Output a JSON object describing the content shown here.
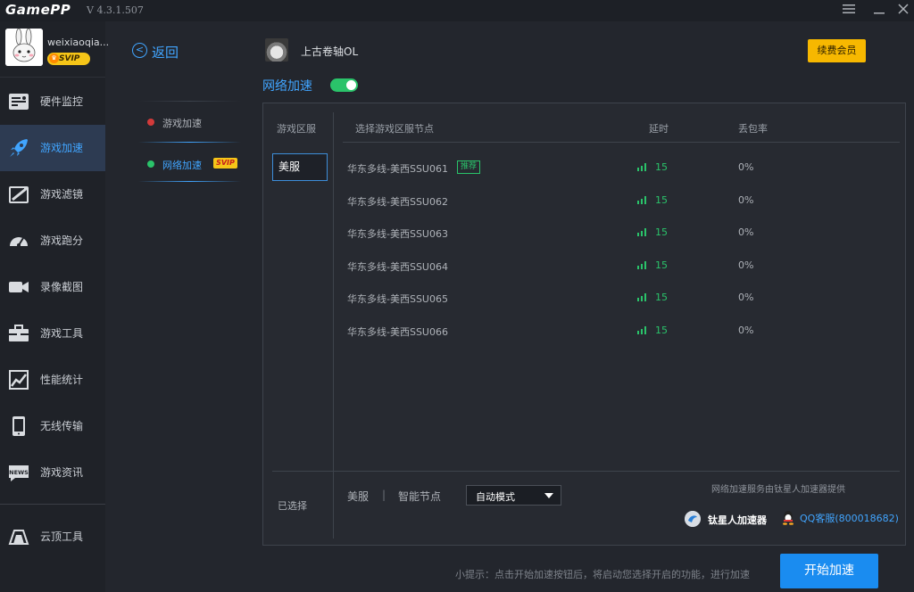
{
  "app": {
    "logo": "GamePP",
    "version": "V 4.3.1.507"
  },
  "window_controls": {
    "menu_icon": "menu-icon",
    "minimize_icon": "minimize-icon",
    "close_icon": "close-icon"
  },
  "user": {
    "name": "weixiaoqia...",
    "badge": "SVIP"
  },
  "sidebar": {
    "items": [
      {
        "label": "硬件监控",
        "icon": "hardware-monitor-icon"
      },
      {
        "label": "游戏加速",
        "icon": "rocket-icon",
        "active": true
      },
      {
        "label": "游戏滤镜",
        "icon": "filter-icon"
      },
      {
        "label": "游戏跑分",
        "icon": "speedometer-icon"
      },
      {
        "label": "录像截图",
        "icon": "video-camera-icon"
      },
      {
        "label": "游戏工具",
        "icon": "toolbox-icon"
      },
      {
        "label": "性能统计",
        "icon": "chart-icon"
      },
      {
        "label": "无线传输",
        "icon": "phone-icon"
      },
      {
        "label": "游戏资讯",
        "icon": "news-icon"
      }
    ],
    "bottom_item": {
      "label": "云顶工具",
      "icon": "cloud-peak-icon"
    }
  },
  "subnav": {
    "back_label": "返回",
    "items": [
      {
        "label": "游戏加速",
        "dot_color": "#d23a3a"
      },
      {
        "label": "网络加速",
        "dot_color": "#2ac36a",
        "active": true,
        "badge": "SVIP"
      }
    ]
  },
  "game": {
    "name": "上古卷轴OL",
    "renew_label": "续费会员"
  },
  "network": {
    "title": "网络加速",
    "enabled": true
  },
  "table": {
    "headers": {
      "region": "游戏区服",
      "node": "选择游戏区服节点",
      "latency": "延时",
      "loss": "丢包率"
    },
    "regions": [
      "美服"
    ],
    "rows": [
      {
        "node": "华东多线-美西SSU061",
        "tag": "推荐",
        "latency": "15",
        "loss": "0%"
      },
      {
        "node": "华东多线-美西SSU062",
        "tag": "",
        "latency": "15",
        "loss": "0%"
      },
      {
        "node": "华东多线-美西SSU063",
        "tag": "",
        "latency": "15",
        "loss": "0%"
      },
      {
        "node": "华东多线-美西SSU064",
        "tag": "",
        "latency": "15",
        "loss": "0%"
      },
      {
        "node": "华东多线-美西SSU065",
        "tag": "",
        "latency": "15",
        "loss": "0%"
      },
      {
        "node": "华东多线-美西SSU066",
        "tag": "",
        "latency": "15",
        "loss": "0%"
      }
    ]
  },
  "selection": {
    "label": "已选择",
    "region": "美服",
    "separator": "|",
    "node": "智能节点",
    "mode": "自动模式"
  },
  "provider": {
    "note": "网络加速服务由钛星人加速器提供",
    "brand": "钛星人加速器",
    "qq": "QQ客服(800018682)"
  },
  "footer": {
    "hint": "小提示：点击开始加速按钮后，将启动您选择开启的功能，进行加速",
    "start_label": "开始加速"
  },
  "colors": {
    "accent": "#41a5ff",
    "good": "#2ac36a",
    "vip": "#f7b800",
    "primary_button": "#1a8cf0"
  }
}
